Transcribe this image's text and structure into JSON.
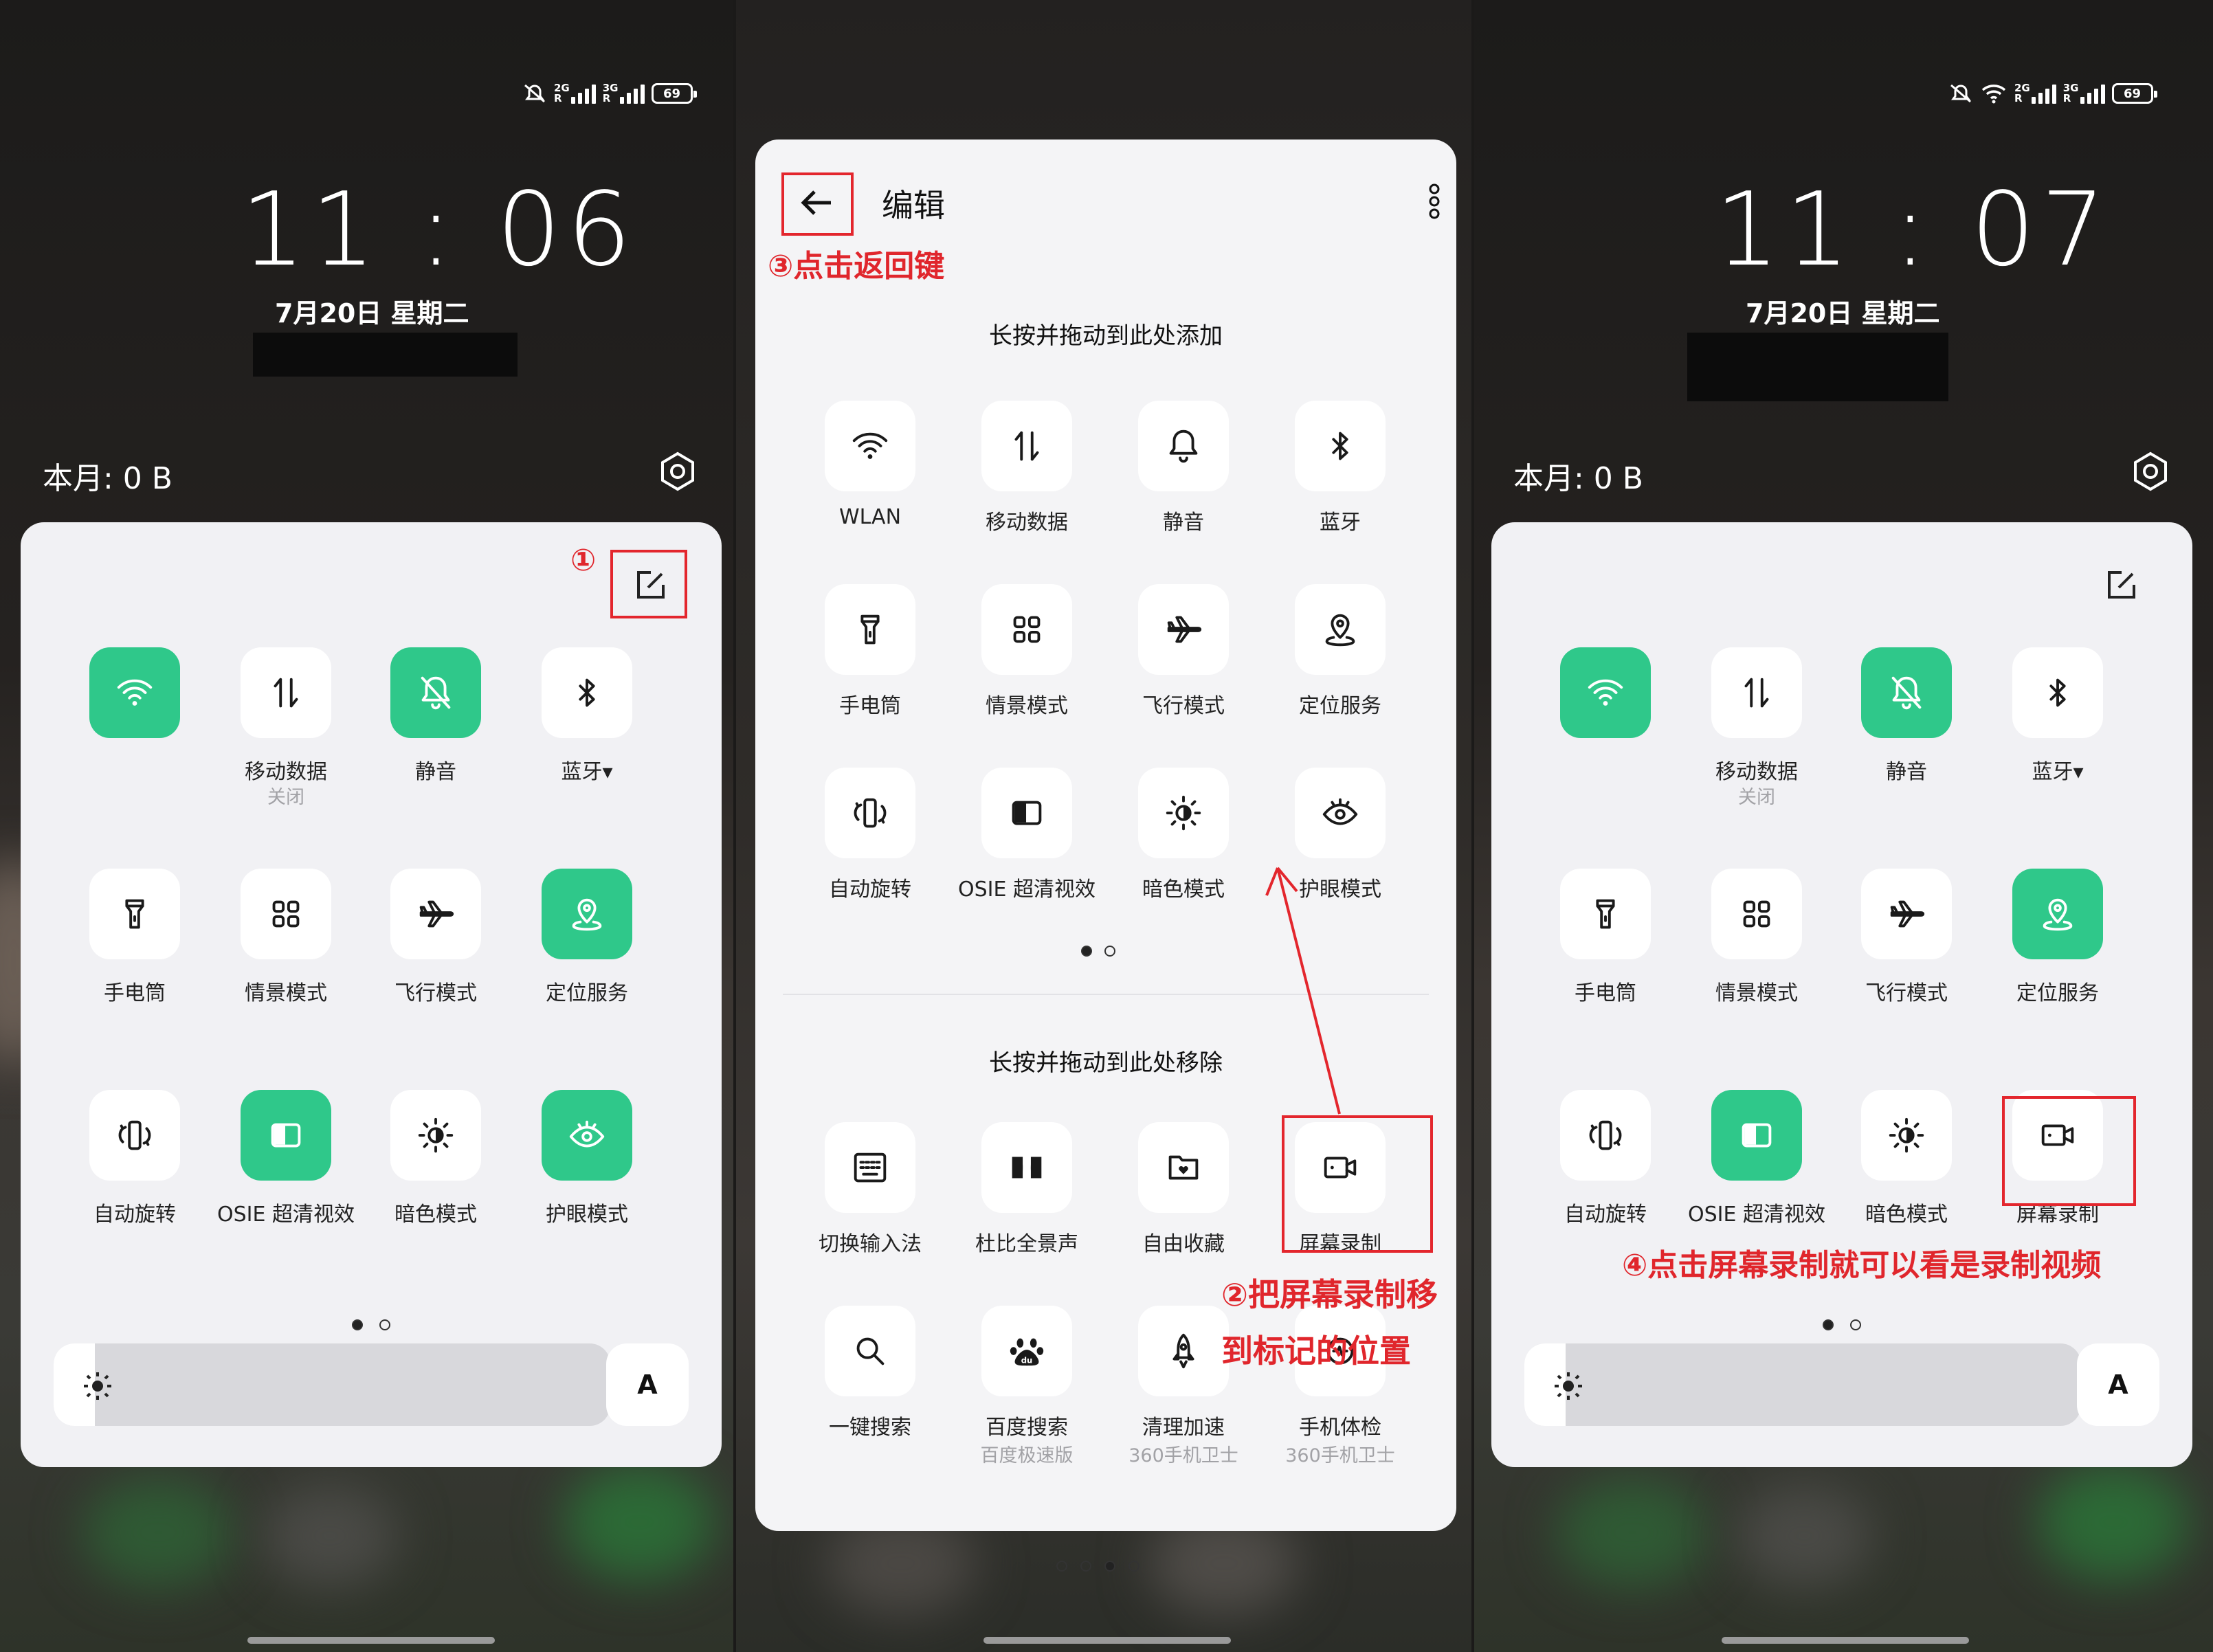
{
  "status": {
    "sig1": "2G",
    "sig2": "3G",
    "sig1_r": "R",
    "sig2_r": "R",
    "battery": "69"
  },
  "left": {
    "time": "11 : 06",
    "date": "7月20日  星期二",
    "month_usage": "本月: 0 B",
    "annotation": "①",
    "tiles": [
      {
        "label": "",
        "sub": "",
        "icon": "wifi-icon",
        "on": true
      },
      {
        "label": "移动数据",
        "sub": "关闭",
        "icon": "mobile-data-icon",
        "on": false
      },
      {
        "label": "静音",
        "sub": "",
        "icon": "mute-bell-icon",
        "on": true
      },
      {
        "label": "蓝牙▾",
        "sub": "",
        "icon": "bluetooth-icon",
        "on": false
      },
      {
        "label": "手电筒",
        "sub": "",
        "icon": "flashlight-icon",
        "on": false
      },
      {
        "label": "情景模式",
        "sub": "",
        "icon": "scene-mode-icon",
        "on": false
      },
      {
        "label": "飞行模式",
        "sub": "",
        "icon": "airplane-icon",
        "on": false
      },
      {
        "label": "定位服务",
        "sub": "",
        "icon": "location-icon",
        "on": true
      },
      {
        "label": "自动旋转",
        "sub": "",
        "icon": "auto-rotate-icon",
        "on": false
      },
      {
        "label": "OSIE 超清视效",
        "sub": "",
        "icon": "osie-icon",
        "on": true
      },
      {
        "label": "暗色模式",
        "sub": "",
        "icon": "dark-mode-icon",
        "on": false
      },
      {
        "label": "护眼模式",
        "sub": "",
        "icon": "eye-care-icon",
        "on": true
      }
    ],
    "auto_brightness": "A"
  },
  "middle": {
    "title": "编辑",
    "annotation_back": "③点击返回键",
    "section_add": "长按并拖动到此处添加",
    "section_remove": "长按并拖动到此处移除",
    "annotation_move_1": "②把屏幕录制移",
    "annotation_move_2": "到标记的位置",
    "active_tiles": [
      {
        "label": "WLAN",
        "icon": "wifi-icon"
      },
      {
        "label": "移动数据",
        "icon": "mobile-data-icon"
      },
      {
        "label": "静音",
        "icon": "bell-icon"
      },
      {
        "label": "蓝牙",
        "icon": "bluetooth-icon"
      },
      {
        "label": "手电筒",
        "icon": "flashlight-icon"
      },
      {
        "label": "情景模式",
        "icon": "scene-mode-icon"
      },
      {
        "label": "飞行模式",
        "icon": "airplane-icon"
      },
      {
        "label": "定位服务",
        "icon": "location-icon"
      },
      {
        "label": "自动旋转",
        "icon": "auto-rotate-icon"
      },
      {
        "label": "OSIE 超清视效",
        "icon": "osie-icon"
      },
      {
        "label": "暗色模式",
        "icon": "dark-mode-icon"
      },
      {
        "label": "护眼模式",
        "icon": "eye-care-icon"
      }
    ],
    "available_tiles": [
      {
        "label": "切换输入法",
        "sub": "",
        "icon": "keyboard-icon"
      },
      {
        "label": "杜比全景声",
        "sub": "",
        "icon": "dolby-icon"
      },
      {
        "label": "自由收藏",
        "sub": "",
        "icon": "favorite-folder-icon"
      },
      {
        "label": "屏幕录制",
        "sub": "",
        "icon": "screen-record-icon"
      },
      {
        "label": "一键搜索",
        "sub": "",
        "icon": "search-icon"
      },
      {
        "label": "百度搜索",
        "sub": "百度极速版",
        "icon": "baidu-icon"
      },
      {
        "label": "清理加速",
        "sub": "360手机卫士",
        "icon": "rocket-icon"
      },
      {
        "label": "手机体检",
        "sub": "360手机卫士",
        "icon": "checkup-icon"
      }
    ]
  },
  "right": {
    "time": "11 : 07",
    "date": "7月20日  星期二",
    "month_usage": "本月: 0 B",
    "annotation": "④点击屏幕录制就可以看是录制视频",
    "tiles": [
      {
        "label": "",
        "sub": "",
        "icon": "wifi-icon",
        "on": true
      },
      {
        "label": "移动数据",
        "sub": "关闭",
        "icon": "mobile-data-icon",
        "on": false
      },
      {
        "label": "静音",
        "sub": "",
        "icon": "mute-bell-icon",
        "on": true
      },
      {
        "label": "蓝牙▾",
        "sub": "",
        "icon": "bluetooth-icon",
        "on": false
      },
      {
        "label": "手电筒",
        "sub": "",
        "icon": "flashlight-icon",
        "on": false
      },
      {
        "label": "情景模式",
        "sub": "",
        "icon": "scene-mode-icon",
        "on": false
      },
      {
        "label": "飞行模式",
        "sub": "",
        "icon": "airplane-icon",
        "on": false
      },
      {
        "label": "定位服务",
        "sub": "",
        "icon": "location-icon",
        "on": true
      },
      {
        "label": "自动旋转",
        "sub": "",
        "icon": "auto-rotate-icon",
        "on": false
      },
      {
        "label": "OSIE 超清视效",
        "sub": "",
        "icon": "osie-icon",
        "on": true
      },
      {
        "label": "暗色模式",
        "sub": "",
        "icon": "dark-mode-icon",
        "on": false
      },
      {
        "label": "屏幕录制",
        "sub": "",
        "icon": "screen-record-icon",
        "on": false
      }
    ],
    "auto_brightness": "A"
  },
  "colors": {
    "accent_green": "#2fc88a",
    "annotation_red": "#e3262d",
    "panel_bg": "#f1f1f4"
  }
}
